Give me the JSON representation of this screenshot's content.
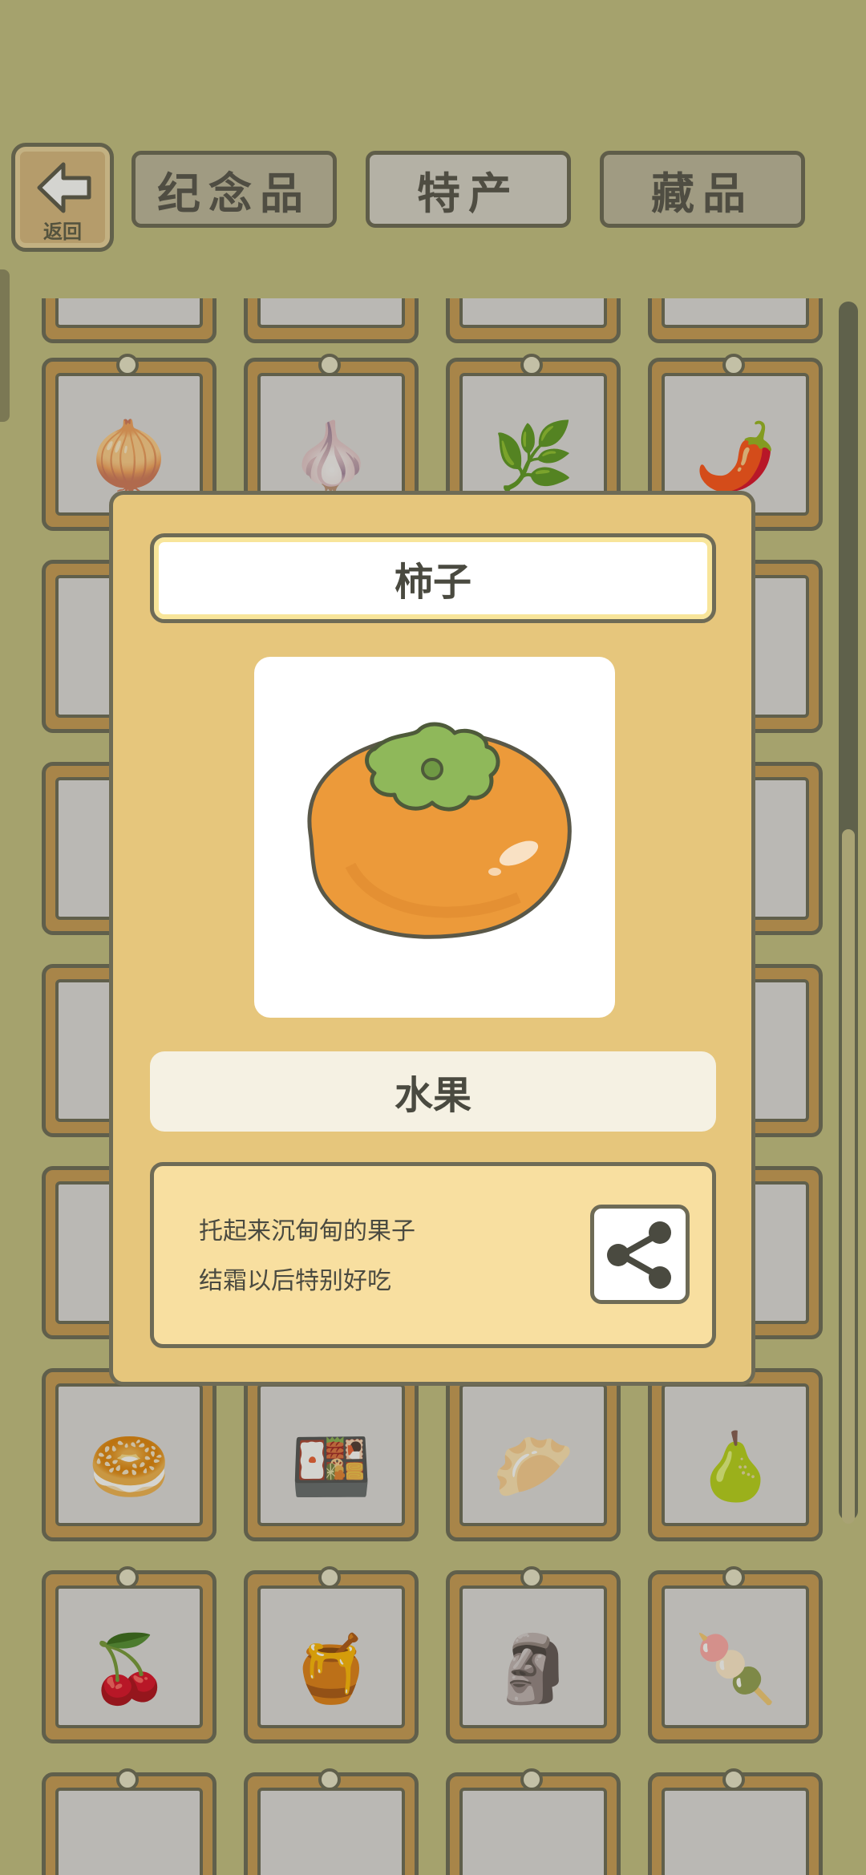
{
  "header": {
    "back_label": "返回",
    "tabs": [
      {
        "label": "纪念品",
        "active": false
      },
      {
        "label": "特产",
        "active": true
      },
      {
        "label": "藏品",
        "active": false
      }
    ]
  },
  "grid": {
    "items": [
      {
        "name": "onion",
        "glyph": "🧅"
      },
      {
        "name": "garlic",
        "glyph": "🧄"
      },
      {
        "name": "green-onion",
        "glyph": "🌿"
      },
      {
        "name": "chili-pepper",
        "glyph": "🌶️"
      },
      {
        "name": "bread-plate",
        "glyph": "🥯"
      },
      {
        "name": "takeout-box",
        "glyph": "🍱"
      },
      {
        "name": "dumpling-plate",
        "glyph": "🥟"
      },
      {
        "name": "pear",
        "glyph": "🍐"
      },
      {
        "name": "cherries",
        "glyph": "🍒"
      },
      {
        "name": "honey-jar",
        "glyph": "🍯"
      },
      {
        "name": "bronze-mask-keychain",
        "glyph": "🗿"
      },
      {
        "name": "pink-mask-popsicle",
        "glyph": "🍡"
      }
    ]
  },
  "modal": {
    "title": "柿子",
    "image_icon": "persimmon-icon",
    "category": "水果",
    "description_lines": [
      "托起来沉甸甸的果子",
      "结霜以后特别好吃"
    ],
    "share_icon": "share-icon"
  },
  "colors": {
    "background": "#c3bf80",
    "modal_bg": "#e6c67c",
    "card_frame": "#c79a52",
    "persimmon": "#ec9a3a",
    "leaf": "#8fb85a"
  }
}
